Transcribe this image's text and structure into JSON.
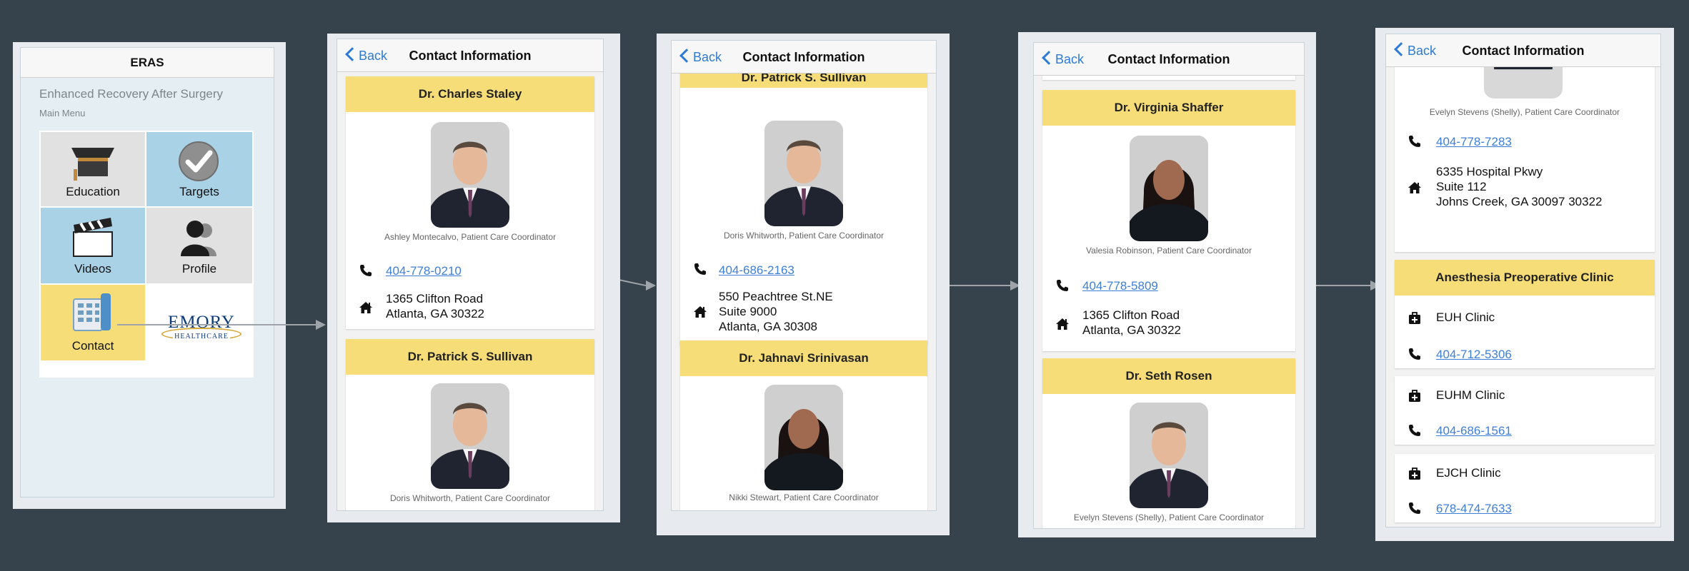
{
  "s1": {
    "title": "ERAS",
    "subtitle": "Enhanced Recovery After Surgery",
    "menu_label": "Main Menu",
    "tiles": [
      "Education",
      "Targets",
      "Videos",
      "Profile",
      "Contact"
    ],
    "logo_top": "EMORY",
    "logo_bottom": "HEALTHCARE"
  },
  "nav": {
    "back": "Back",
    "title": "Contact Information"
  },
  "s2": {
    "card1": {
      "name": "Dr. Charles Staley",
      "coord": "Ashley Montecalvo, Patient Care Coordinator",
      "phone": "404-778-0210",
      "addr1": "1365 Clifton Road",
      "addr2": "Atlanta, GA 30322"
    },
    "card2": {
      "name": "Dr. Patrick S. Sullivan",
      "coord": "Doris Whitworth, Patient Care Coordinator"
    }
  },
  "s3": {
    "card1": {
      "name": "Dr. Patrick S. Sullivan",
      "coord": "Doris Whitworth, Patient Care Coordinator",
      "phone": "404-686-2163",
      "addr1": "550 Peachtree St.NE",
      "addr2": "Suite 9000",
      "addr3": "Atlanta, GA 30308"
    },
    "card2": {
      "name": "Dr. Jahnavi Srinivasan",
      "coord": "Nikki Stewart, Patient Care Coordinator"
    }
  },
  "s4": {
    "card1": {
      "name": "Dr. Virginia Shaffer",
      "coord": "Valesia Robinson, Patient Care Coordinator",
      "phone": "404-778-5809",
      "addr1": "1365 Clifton Road",
      "addr2": "Atlanta, GA 30322"
    },
    "card2": {
      "name": "Dr. Seth Rosen",
      "coord": "Evelyn Stevens (Shelly), Patient Care Coordinator"
    }
  },
  "s5": {
    "coord": "Evelyn Stevens (Shelly), Patient Care Coordinator",
    "phone": "404-778-7283",
    "addr1": "6335 Hospital Pkwy",
    "addr2": "Suite 112",
    "addr3": "Johns Creek, GA 30097 30322",
    "clinic_header": "Anesthesia Preoperative Clinic",
    "clinics": [
      {
        "name": "EUH Clinic",
        "phone": "404-712-5306"
      },
      {
        "name": "EUHM Clinic",
        "phone": "404-686-1561"
      },
      {
        "name": "EJCH Clinic",
        "phone": "678-474-7633"
      }
    ]
  },
  "colors": {
    "background": "#37434c",
    "card_header": "#f6dd78",
    "link": "#3d7fd8",
    "tile_blue": "#a9d2e6",
    "tile_gray": "#e1e1e1",
    "tile_yellow": "#f6dd78"
  }
}
